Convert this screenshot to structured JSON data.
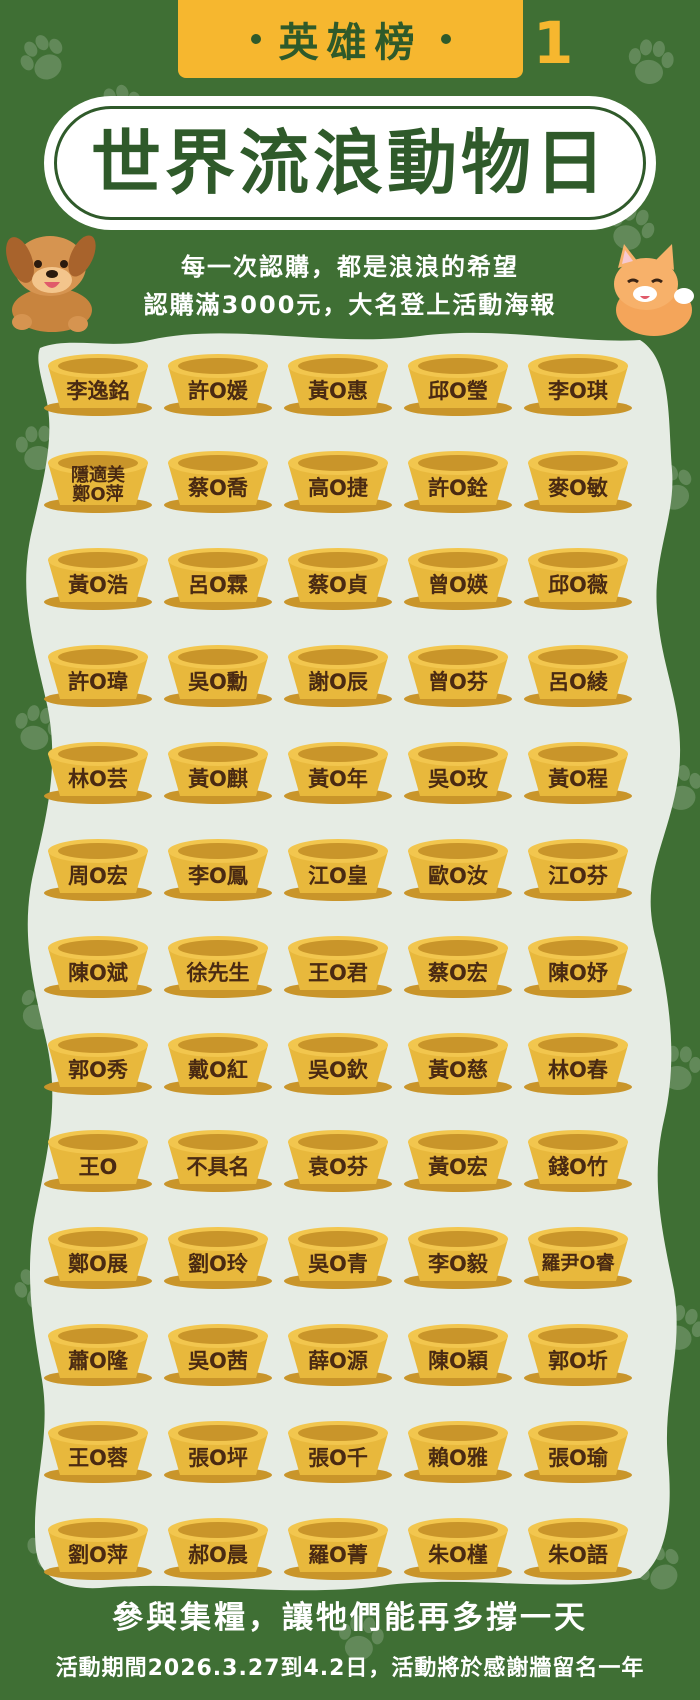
{
  "header": {
    "banner_title": "英雄榜",
    "page_number": "1"
  },
  "title": "世界流浪動物日",
  "subtitle": {
    "line1": "每一次認購，都是浪浪的希望",
    "line2": "認購滿3000元，大名登上活動海報"
  },
  "donors": [
    [
      "李逸銘",
      "許O媛",
      "黃O惠",
      "邱O瑩",
      "李O琪"
    ],
    [
      "隱適美|鄭O萍",
      "蔡O喬",
      "高O捷",
      "許O銓",
      "麥O敏"
    ],
    [
      "黃O浩",
      "呂O霖",
      "蔡O貞",
      "曾O媖",
      "邱O薇"
    ],
    [
      "許O瑋",
      "吳O勳",
      "謝O辰",
      "曾O芬",
      "呂O綾"
    ],
    [
      "林O芸",
      "黃O麒",
      "黃O年",
      "吳O玫",
      "黃O程"
    ],
    [
      "周O宏",
      "李O鳳",
      "江O皇",
      "歐O汝",
      "江O芬"
    ],
    [
      "陳O斌",
      "徐先生",
      "王O君",
      "蔡O宏",
      "陳O妤"
    ],
    [
      "郭O秀",
      "戴O紅",
      "吳O欽",
      "黃O慈",
      "林O春"
    ],
    [
      "王O",
      "不具名",
      "袁O芬",
      "黃O宏",
      "錢O竹"
    ],
    [
      "鄭O展",
      "劉O玲",
      "吳O青",
      "李O毅",
      "羅尹O睿"
    ],
    [
      "蕭O隆",
      "吳O茜",
      "薛O源",
      "陳O穎",
      "郭O圻"
    ],
    [
      "王O蓉",
      "張O坪",
      "張O千",
      "賴O雅",
      "張O瑜"
    ],
    [
      "劉O萍",
      "郝O晨",
      "羅O菁",
      "朱O槿",
      "朱O語"
    ]
  ],
  "footer": {
    "line1": "參與集糧，讓牠們能再多撐一天",
    "line2": "活動期間2026.3.27到4.2日，活動將於感謝牆留名一年"
  },
  "colors": {
    "background_green": "#3f6f34",
    "dark_green": "#2f5a2a",
    "banner_yellow": "#f6b72f",
    "bowl_gold": "#e8b83c",
    "bowl_dark": "#c9952a",
    "panel_mint": "#e6ece4",
    "name_brown": "#4a2a12"
  },
  "icons": {
    "dog": "dog-illustration",
    "cat": "cat-illustration",
    "paw": "paw-print-icon",
    "bowl": "pet-bowl-icon"
  }
}
